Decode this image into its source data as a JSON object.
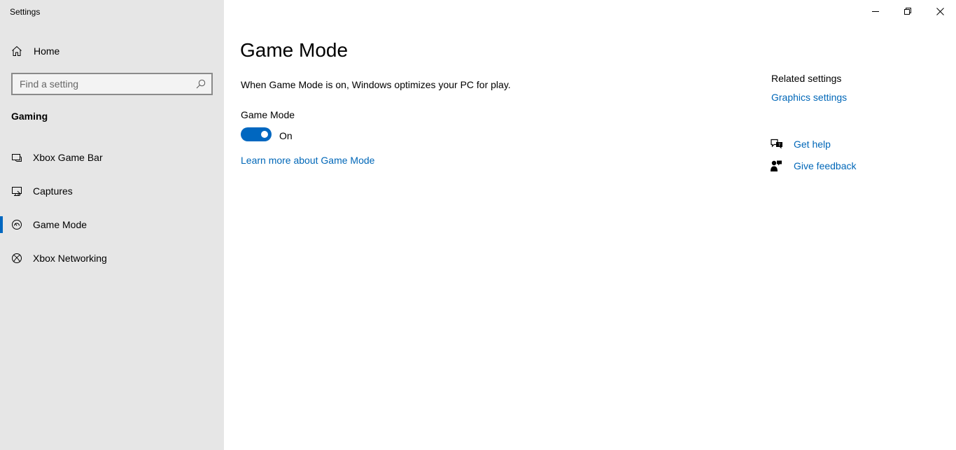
{
  "window": {
    "title": "Settings"
  },
  "sidebar": {
    "home_label": "Home",
    "search_placeholder": "Find a setting",
    "section_title": "Gaming",
    "items": [
      {
        "label": "Xbox Game Bar",
        "icon": "xbox-game-bar-icon",
        "selected": false
      },
      {
        "label": "Captures",
        "icon": "captures-icon",
        "selected": false
      },
      {
        "label": "Game Mode",
        "icon": "game-mode-icon",
        "selected": true
      },
      {
        "label": "Xbox Networking",
        "icon": "xbox-icon",
        "selected": false
      }
    ]
  },
  "main": {
    "title": "Game Mode",
    "description": "When Game Mode is on, Windows optimizes your PC for play.",
    "toggle_label": "Game Mode",
    "toggle_state": "On",
    "learn_more": "Learn more about Game Mode"
  },
  "related": {
    "title": "Related settings",
    "link": "Graphics settings",
    "get_help": "Get help",
    "give_feedback": "Give feedback"
  },
  "colors": {
    "accent": "#0067c0",
    "link": "#0067b8",
    "sidebar_bg": "#e6e6e6"
  }
}
